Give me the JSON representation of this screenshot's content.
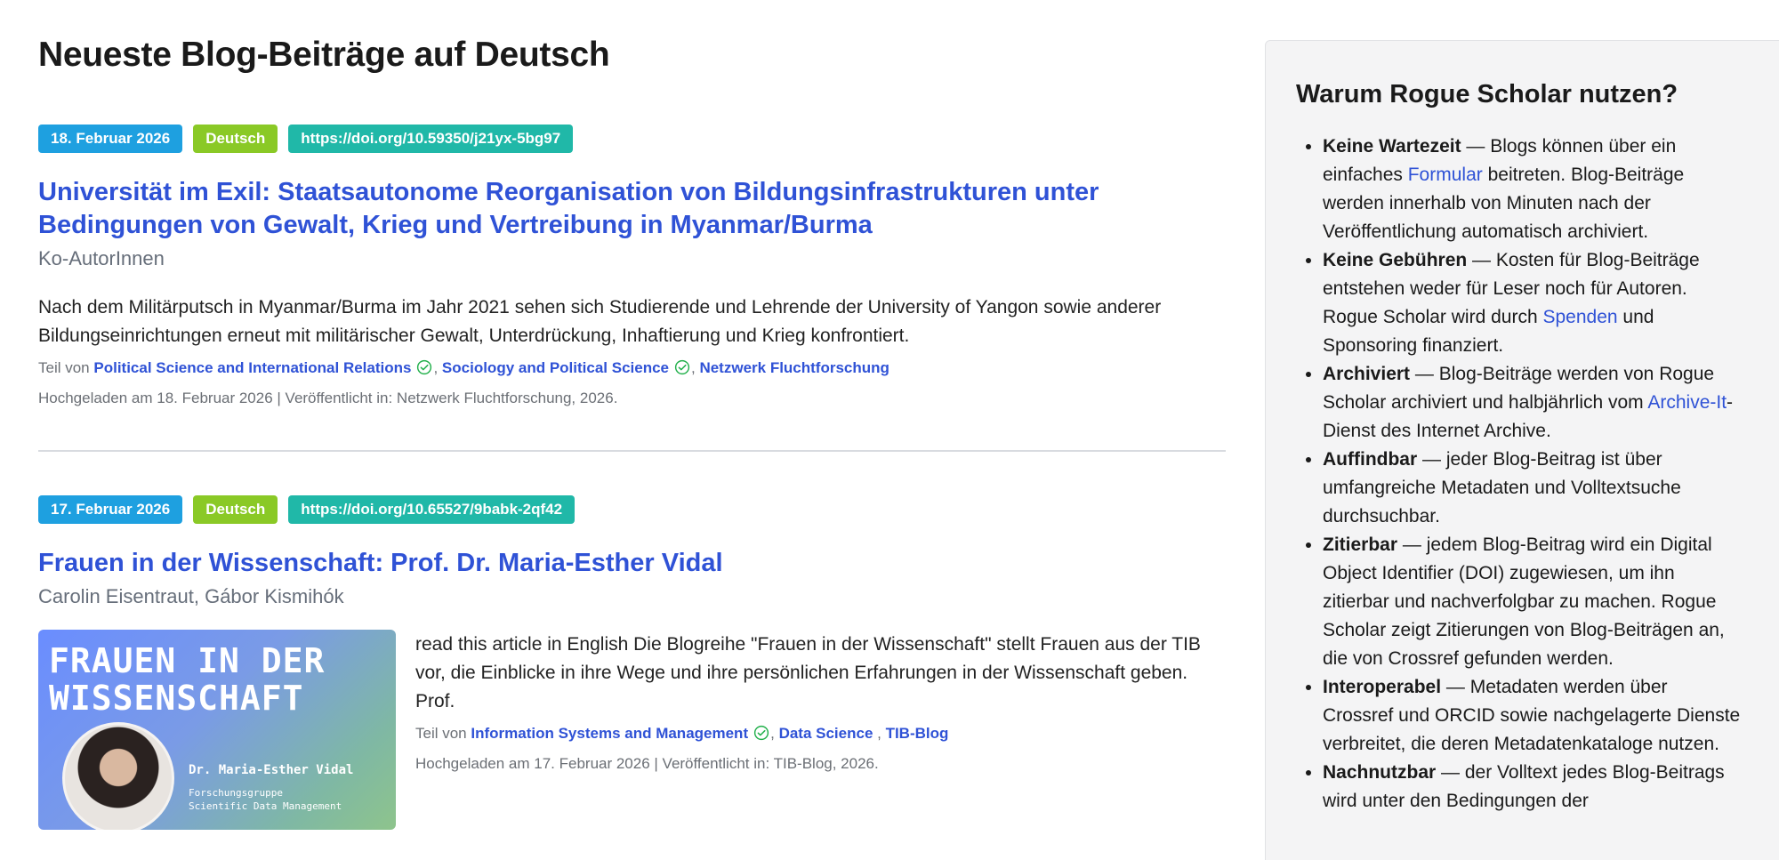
{
  "page": {
    "title": "Neueste Blog-Beiträge auf Deutsch"
  },
  "posts": [
    {
      "date": "18. Februar 2026",
      "language": "Deutsch",
      "doi": "https://doi.org/10.59350/j21yx-5bg97",
      "title": "Universität im Exil: Staatsautonome Reorganisation von Bildungsinfrastrukturen unter Bedingungen von Gewalt, Krieg und Vertreibung in Myanmar/Burma",
      "authors": "Ko-AutorInnen",
      "excerpt": "Nach dem Militärputsch in Myanmar/Burma im Jahr 2021 sehen sich Studierende und Lehrende der University of Yangon sowie anderer Bildungseinrichtungen erneut mit militärischer Gewalt, Unterdrückung, Inhaftierung und Krieg konfrontiert.",
      "part_of_label": "Teil von",
      "communities": [
        "Political Science and International Relations",
        "Sociology and Political Science",
        "Netzwerk Fluchtforschung"
      ],
      "meta": "Hochgeladen am 18. Februar 2026 | Veröffentlicht in: Netzwerk Fluchtforschung, 2026."
    },
    {
      "date": "17. Februar 2026",
      "language": "Deutsch",
      "doi": "https://doi.org/10.65527/9babk-2qf42",
      "title": "Frauen in der Wissenschaft: Prof. Dr. Maria-Esther Vidal",
      "authors": "Carolin Eisentraut, Gábor Kismihók",
      "thumbnail": {
        "title_line1": "FRAUEN IN DER",
        "title_line2": "WISSENSCHAFT",
        "name": "Dr. Maria-Esther Vidal",
        "group_line1": "Forschungsgruppe",
        "group_line2": "Scientific Data Management"
      },
      "excerpt": "read this article in English Die Blogreihe \"Frauen in der Wissenschaft\" stellt Frauen aus der TIB vor, die Einblicke in ihre Wege und ihre persönlichen Erfahrungen in der Wissenschaft geben. Prof.",
      "part_of_label": "Teil von",
      "communities": [
        "Information Systems and Management",
        "Data Science",
        "TIB-Blog"
      ],
      "meta": "Hochgeladen am 17. Februar 2026 | Veröffentlicht in: TIB-Blog, 2026."
    }
  ],
  "sidebar": {
    "title": "Warum Rogue Scholar nutzen?",
    "items": [
      {
        "term": "Keine Wartezeit",
        "pre": " — Blogs können über ein einfaches ",
        "link": "Formular",
        "post": " beitreten. Blog-Beiträge werden innerhalb von Minuten nach der Veröffentlichung automatisch archiviert."
      },
      {
        "term": "Keine Gebühren",
        "pre": " — Kosten für Blog-Beiträge entstehen weder für Leser noch für Autoren. Rogue Scholar wird durch ",
        "link": "Spenden",
        "post": " und Sponsoring finanziert."
      },
      {
        "term": "Archiviert",
        "pre": " — Blog-Beiträge werden von Rogue Scholar archiviert und halbjährlich vom ",
        "link": "Archive-It",
        "post": "-Dienst des Internet Archive."
      },
      {
        "term": "Auffindbar",
        "text": " — jeder Blog-Beitrag ist über umfangreiche Metadaten und Volltextsuche durchsuchbar."
      },
      {
        "term": "Zitierbar",
        "text": " — jedem Blog-Beitrag wird ein Digital Object Identifier (DOI) zugewiesen, um ihn zitierbar und nachverfolgbar zu machen. Rogue Scholar zeigt Zitierungen von Blog-Beiträgen an, die von Crossref gefunden werden."
      },
      {
        "term": "Interoperabel",
        "text": " — Metadaten werden über Crossref und ORCID sowie nachgelagerte Dienste verbreitet, die deren Metadatenkataloge nutzen."
      },
      {
        "term": "Nachnutzbar",
        "text": " — der Volltext jedes Blog-Beitrags wird unter den Bedingungen der"
      }
    ]
  }
}
